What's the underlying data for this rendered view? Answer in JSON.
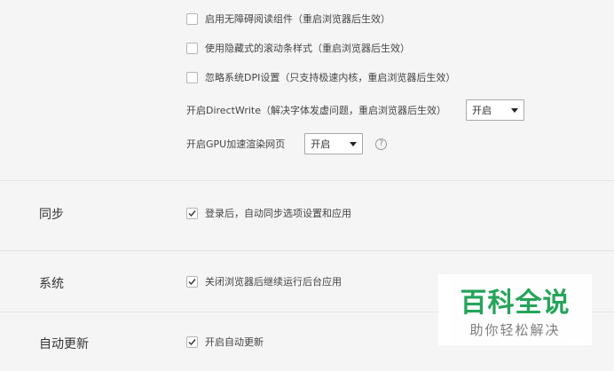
{
  "advanced": {
    "options": [
      {
        "label": "启用无障碍阅读组件（重启浏览器后生效）",
        "checked": false
      },
      {
        "label": "使用隐藏式的滚动条样式（重启浏览器后生效）",
        "checked": false
      },
      {
        "label": "忽略系统DPI设置（只支持极速内核，重启浏览器后生效）",
        "checked": false
      }
    ],
    "directwrite": {
      "label": "开启DirectWrite（解决字体发虚问题，重启浏览器后生效）",
      "value": "开启"
    },
    "gpu": {
      "label": "开启GPU加速渲染网页",
      "value": "开启",
      "help": "?"
    }
  },
  "sync": {
    "title": "同步",
    "option": {
      "label": "登录后，自动同步选项设置和应用",
      "checked": true
    }
  },
  "system": {
    "title": "系统",
    "option": {
      "label": "关闭浏览器后继续运行后台应用",
      "checked": true
    }
  },
  "update": {
    "title": "自动更新",
    "option": {
      "label": "开启自动更新",
      "checked": true
    }
  },
  "watermark": {
    "title": "百科全说",
    "subtitle": "助你轻松解决"
  },
  "colors": {
    "brand": "#1aa052",
    "border": "#b5b5b5",
    "background": "#f5f5f5"
  }
}
